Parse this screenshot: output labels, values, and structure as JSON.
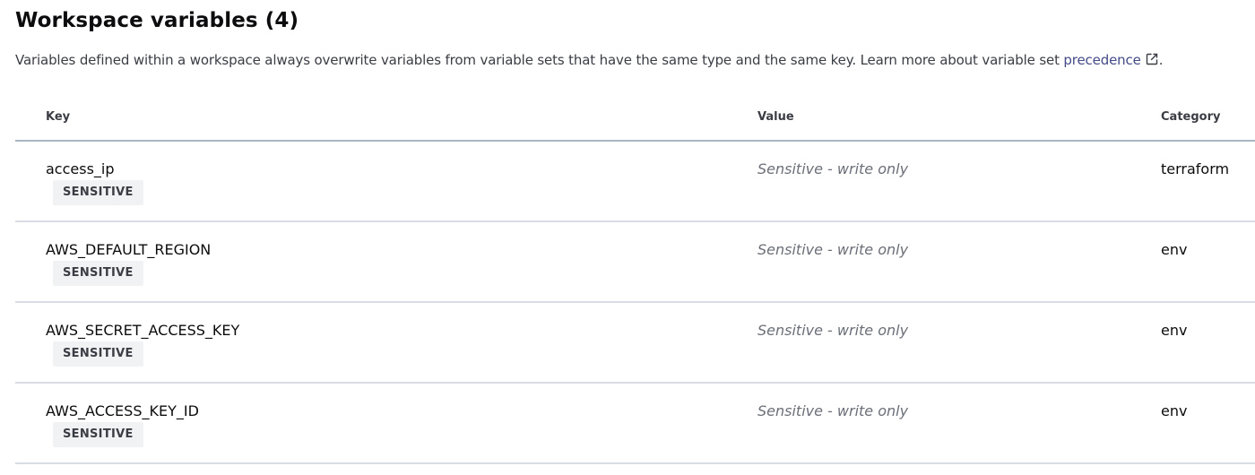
{
  "header": {
    "title": "Workspace variables (4)",
    "description": "Variables defined within a workspace always overwrite variables from variable sets that have the same type and the same key. Learn more about variable set ",
    "link_text": "precedence",
    "link_icon": "external-link-icon",
    "description_end": "."
  },
  "table": {
    "columns": {
      "key": "Key",
      "value": "Value",
      "category": "Category"
    },
    "rows": [
      {
        "key": "access_ip",
        "badge": "SENSITIVE",
        "value": "Sensitive - write only",
        "category": "terraform"
      },
      {
        "key": "AWS_DEFAULT_REGION",
        "badge": "SENSITIVE",
        "value": "Sensitive - write only",
        "category": "env"
      },
      {
        "key": "AWS_SECRET_ACCESS_KEY",
        "badge": "SENSITIVE",
        "value": "Sensitive - write only",
        "category": "env"
      },
      {
        "key": "AWS_ACCESS_KEY_ID",
        "badge": "SENSITIVE",
        "value": "Sensitive - write only",
        "category": "env"
      }
    ]
  },
  "colors": {
    "link": "#444b88",
    "badge_bg": "#f1f2f3",
    "header_border": "#aab5c4",
    "row_border": "#d9dce2"
  }
}
